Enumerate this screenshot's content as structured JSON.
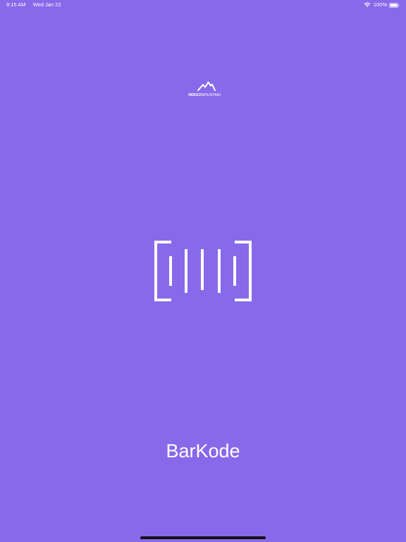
{
  "status_bar": {
    "time": "9:15 AM",
    "date": "Wed Jan 22",
    "battery": "100%",
    "battery_level": 1.0,
    "icons": [
      "wifi-icon",
      "battery-icon"
    ]
  },
  "brand": {
    "name_bold": "INDIGO",
    "name_regular": "MOUNTAIN",
    "icon": "mountain-icon"
  },
  "splash": {
    "logo_icon": "barcode-icon",
    "app_name": "BarKode"
  },
  "colors": {
    "background": "#8869EA",
    "foreground": "#FFFFFF",
    "home_indicator": "#111111"
  }
}
